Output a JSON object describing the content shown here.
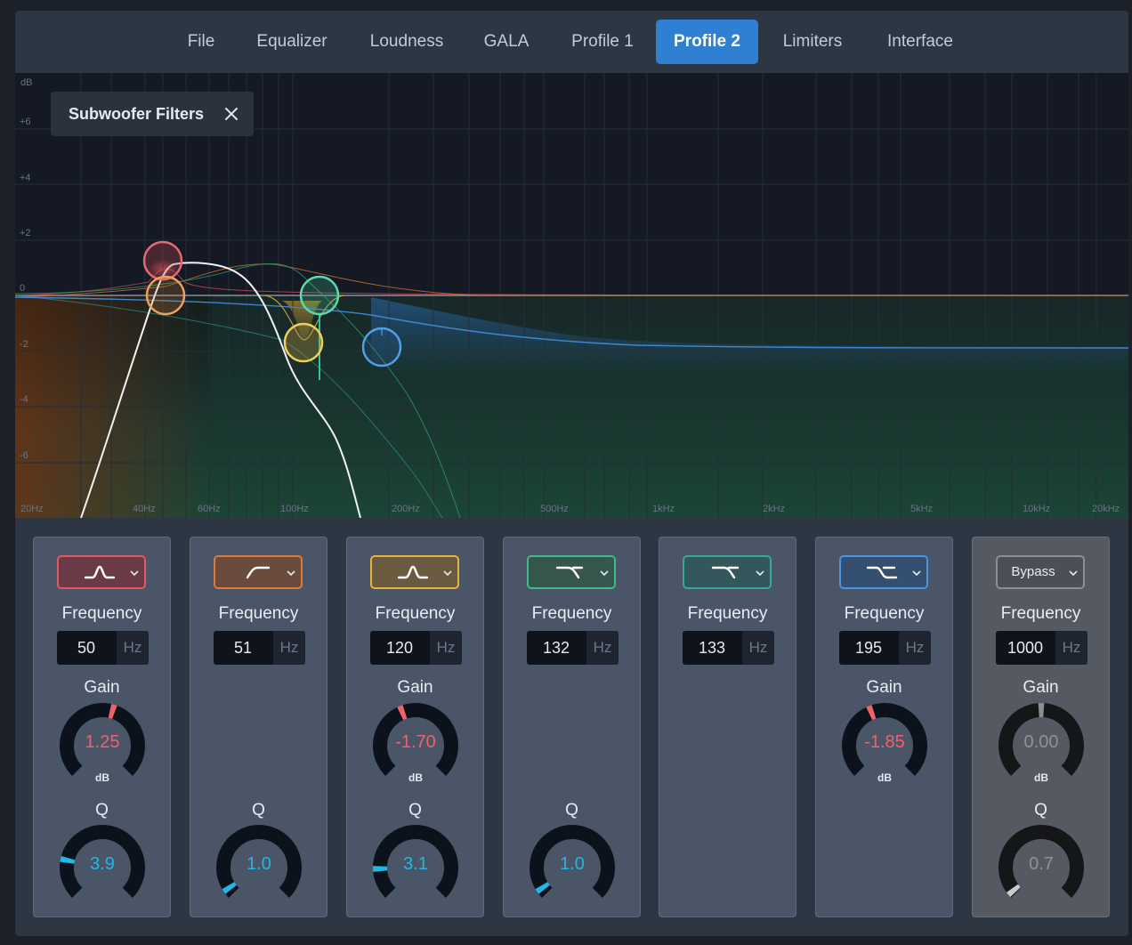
{
  "tabs": [
    {
      "label": "File",
      "active": false
    },
    {
      "label": "Equalizer",
      "active": false
    },
    {
      "label": "Loudness",
      "active": false
    },
    {
      "label": "GALA",
      "active": false
    },
    {
      "label": "Profile 1",
      "active": false
    },
    {
      "label": "Profile 2",
      "active": true
    },
    {
      "label": "Limiters",
      "active": false
    },
    {
      "label": "Interface",
      "active": false
    }
  ],
  "graph": {
    "overlay_title": "Subwoofer Filters",
    "db_axis": [
      "dB",
      "+6",
      "+4",
      "+2",
      "0",
      "-2",
      "-4",
      "-6"
    ],
    "freq_axis": [
      "20Hz",
      "40Hz",
      "60Hz",
      "100Hz",
      "200Hz",
      "500Hz",
      "1kHz",
      "2kHz",
      "5kHz",
      "10kHz",
      "20kHz"
    ]
  },
  "bands": [
    {
      "type_icon": "bell-filter-icon",
      "color": "#e05a60",
      "freq_label": "Frequency",
      "freq": "50",
      "unit": "Hz",
      "gain_label": "Gain",
      "gain": "1.25",
      "gain_unit": "dB",
      "gain_pos": 0.56,
      "q_label": "Q",
      "q": "3.9",
      "q_pos": 0.21
    },
    {
      "type_icon": "high-pass-filter-icon",
      "color": "#e07a3a",
      "freq_label": "Frequency",
      "freq": "51",
      "unit": "Hz",
      "q_label": "Q",
      "q": "1.0",
      "q_pos": 0.04
    },
    {
      "type_icon": "bell-filter-icon",
      "color": "#e9b33b",
      "freq_label": "Frequency",
      "freq": "120",
      "unit": "Hz",
      "gain_label": "Gain",
      "gain": "-1.70",
      "gain_unit": "dB",
      "gain_pos": 0.42,
      "q_label": "Q",
      "q": "3.1",
      "q_pos": 0.16
    },
    {
      "type_icon": "low-pass-filter-icon",
      "color": "#3fba8a",
      "freq_label": "Frequency",
      "freq": "132",
      "unit": "Hz",
      "q_label": "Q",
      "q": "1.0",
      "q_pos": 0.04
    },
    {
      "type_icon": "low-pass-filter-icon",
      "color": "#3aa79c",
      "freq_label": "Frequency",
      "freq": "133",
      "unit": "Hz"
    },
    {
      "type_icon": "high-shelf-filter-icon",
      "color": "#4a96e0",
      "freq_label": "Frequency",
      "freq": "195",
      "unit": "Hz",
      "gain_label": "Gain",
      "gain": "-1.85",
      "gain_unit": "dB",
      "gain_pos": 0.42
    },
    {
      "type_label": "Bypass",
      "color": "#8c9096",
      "freq_label": "Frequency",
      "freq": "1000",
      "unit": "Hz",
      "gain_label": "Gain",
      "gain": "0.00",
      "gain_unit": "dB",
      "gain_pos": 0.5,
      "q_label": "Q",
      "q": "0.7",
      "q_pos": 0.02,
      "bypass": true
    }
  ],
  "colors": {
    "accent": "#2f7fd3",
    "value_red": "#f0626a",
    "value_cyan": "#22b7e4",
    "value_grey": "#8e9296"
  }
}
